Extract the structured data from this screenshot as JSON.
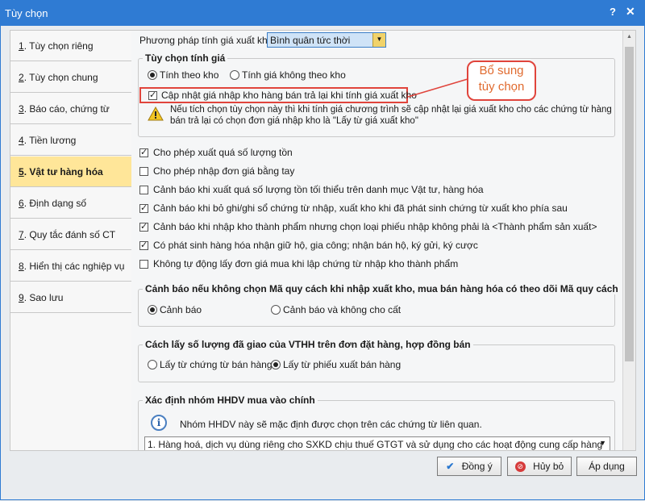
{
  "window": {
    "title": "Tùy chọn",
    "help": "?",
    "close": "✕"
  },
  "sidebar": {
    "items": [
      {
        "num": "1",
        "label": ". Tùy chọn riêng"
      },
      {
        "num": "2",
        "label": ". Tùy chọn chung"
      },
      {
        "num": "3",
        "label": ". Báo cáo, chứng từ"
      },
      {
        "num": "4",
        "label": ". Tiền lương"
      },
      {
        "num": "5",
        "label": ". Vật tư hàng hóa"
      },
      {
        "num": "6",
        "label": ". Định dạng số"
      },
      {
        "num": "7",
        "label": ". Quy tắc đánh số CT"
      },
      {
        "num": "8",
        "label": ". Hiển thị các nghiệp vụ"
      },
      {
        "num": "9",
        "label": ". Sao lưu"
      }
    ],
    "active_index": 4
  },
  "content": {
    "method_label": "Phương pháp tính giá xuất kho",
    "method_value": "Bình quân tức thời",
    "pricing": {
      "title": "Tùy chọn tính giá",
      "radio1": "Tính theo kho",
      "radio2": "Tính giá không theo kho",
      "update_checkbox": "Cập nhật giá nhập kho hàng bán trả lại khi tính giá xuất kho",
      "warning_line1": "Nếu tích chọn tùy chọn này thì khi tính giá chương trình sẽ cập nhật lại giá xuất kho cho các chứng từ hàng",
      "warning_line2": "bán trả lại có chọn đơn giá nhập kho là \"Lấy từ giá xuất kho\""
    },
    "callout_line1": "Bổ sung",
    "callout_line2": "tùy chọn",
    "options": [
      {
        "label": "Cho phép xuất quá số lượng tồn",
        "checked": true
      },
      {
        "label": "Cho phép nhập đơn giá bằng tay",
        "checked": false
      },
      {
        "label": "Cảnh báo khi xuất quá số lượng tồn tối thiểu trên danh mục Vật tư, hàng hóa",
        "checked": false
      },
      {
        "label": "Cảnh báo khi bỏ ghi/ghi sổ chứng từ nhập, xuất kho khi đã phát sinh chứng từ xuất kho phía sau",
        "checked": true
      },
      {
        "label": "Cảnh báo khi nhập kho thành phẩm nhưng chọn loại phiếu nhập không phải là <Thành phẩm sản xuất>",
        "checked": true
      },
      {
        "label": "Có phát sinh hàng hóa nhận giữ hộ, gia công; nhận bán hộ, ký gửi, ký cược",
        "checked": true
      },
      {
        "label": "Không tự động lấy đơn giá mua khi lập chứng từ nhập kho thành phẩm",
        "checked": false
      }
    ],
    "warn_group": {
      "title": "Cảnh báo nếu không chọn Mã quy cách khi nhập xuất kho, mua bán hàng hóa có theo dõi Mã quy cách",
      "radio1": "Cảnh báo",
      "radio2": "Cảnh báo và không cho cất"
    },
    "qty_group": {
      "title": "Cách lấy số lượng đã giao của VTHH trên đơn đặt hàng, hợp đồng bán",
      "radio1": "Lấy từ chứng từ bán hàng",
      "radio2": "Lấy từ phiếu xuất bán hàng"
    },
    "hhdv_group": {
      "title": "Xác định nhóm HHDV mua vào chính",
      "info": "Nhóm HHDV này sẽ mặc định được chọn trên các chứng từ liên quan.",
      "select_value": "1. Hàng hoá, dịch vụ dùng riêng cho SXKD chịu thuế GTGT và sử dụng cho các hoạt động cung cấp hàng"
    }
  },
  "buttons": {
    "ok": "Đồng ý",
    "cancel": "Hủy bỏ",
    "apply": "Áp dụng"
  },
  "colors": {
    "titlebar": "#2f7bd3",
    "active_item": "#ffe699",
    "highlight_border": "#e0443c",
    "callout_text": "#e06a2e"
  }
}
